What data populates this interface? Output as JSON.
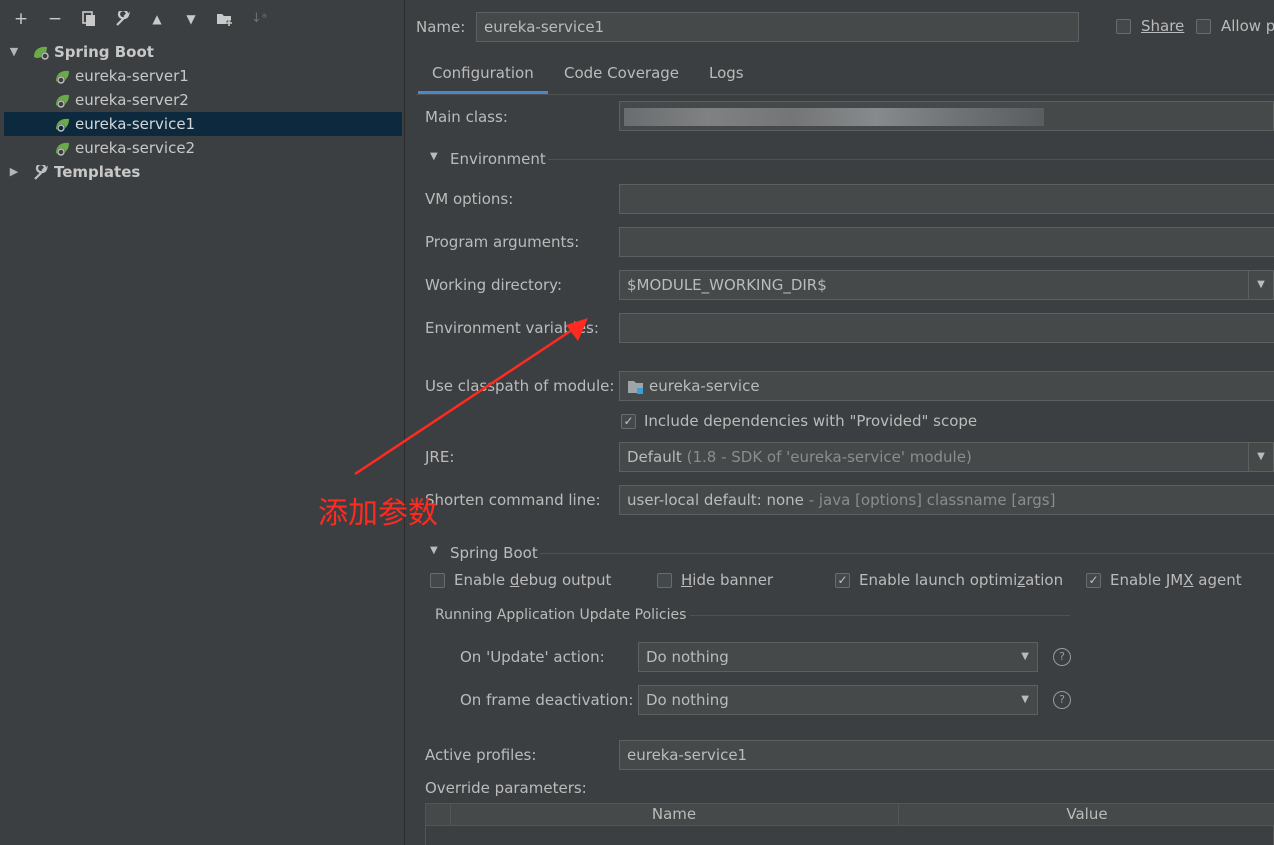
{
  "toolbar": {
    "icons": [
      "add-icon",
      "remove-icon",
      "copy-icon",
      "wrench-icon",
      "move-up-icon",
      "move-down-icon",
      "folder-add-icon",
      "sort-icon"
    ]
  },
  "tree": {
    "group": "Spring Boot",
    "items": [
      "eureka-server1",
      "eureka-server2",
      "eureka-service1",
      "eureka-service2"
    ],
    "templates": "Templates"
  },
  "header": {
    "name_label": "Name:",
    "name_value": "eureka-service1",
    "share_label": "Share",
    "allow_label": "Allow p"
  },
  "tabs": [
    "Configuration",
    "Code Coverage",
    "Logs"
  ],
  "main_class": {
    "label": "Main class:"
  },
  "environment": {
    "title": "Environment",
    "vm_options": "VM options:",
    "program_arguments": "Program arguments:",
    "working_directory": "Working directory:",
    "working_directory_value": "$MODULE_WORKING_DIR$",
    "env_variables": "Environment variables:",
    "classpath_label": "Use classpath of module:",
    "classpath_value": "eureka-service",
    "include_deps": "Include dependencies with \"Provided\" scope",
    "jre_label": "JRE:",
    "jre_value": "Default",
    "jre_hint": "(1.8 - SDK of 'eureka-service' module)",
    "shorten_label": "Shorten command line:",
    "shorten_value": "user-local default: none",
    "shorten_hint": "- java [options] classname [args]"
  },
  "spring_boot": {
    "title": "Spring Boot",
    "debug_a": "Enable ",
    "debug_u": "d",
    "debug_b": "ebug output",
    "hide_u": "H",
    "hide_b": "ide banner",
    "launch_a": "Enable launch optimi",
    "launch_u": "z",
    "launch_b": "ation",
    "jmx_a": "Enable JM",
    "jmx_u": "X",
    "jmx_b": " agent",
    "policies_title": "Running Application Update Policies",
    "update_label": "On 'Update' action:",
    "update_value": "Do nothing",
    "frame_label": "On frame deactivation:",
    "frame_value": "Do nothing",
    "help_glyph": "?"
  },
  "profiles": {
    "active_label": "Active profiles:",
    "active_value": "eureka-service1",
    "override_label": "Override parameters:",
    "col_name": "Name",
    "col_value": "Value"
  },
  "annotation": "添加参数",
  "colors": {
    "accent": "#4a88c7",
    "selection": "#0d293e",
    "annotation": "#ff2a20"
  }
}
